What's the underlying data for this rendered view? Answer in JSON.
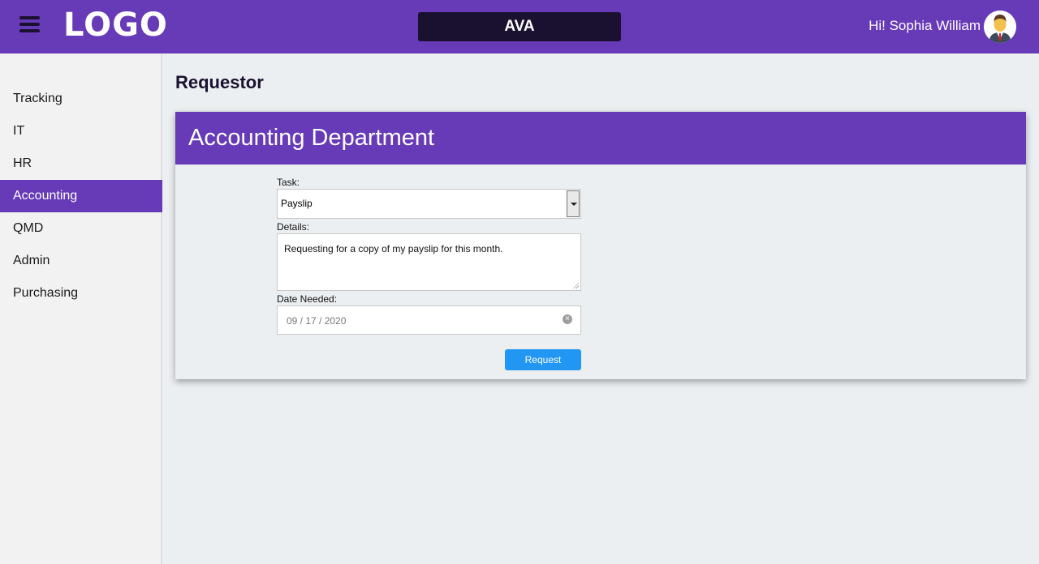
{
  "header": {
    "logo": "LOGO",
    "app_title": "AVA",
    "greeting": "Hi! Sophia William",
    "menu_icon": "hamburger-menu-icon",
    "avatar_icon": "user-avatar"
  },
  "sidebar": {
    "items": [
      {
        "label": "Tracking",
        "active": false
      },
      {
        "label": "IT",
        "active": false
      },
      {
        "label": "HR",
        "active": false
      },
      {
        "label": "Accounting",
        "active": true
      },
      {
        "label": "QMD",
        "active": false
      },
      {
        "label": "Admin",
        "active": false
      },
      {
        "label": "Purchasing",
        "active": false
      }
    ]
  },
  "main": {
    "page_title": "Requestor",
    "card_title": "Accounting Department",
    "form": {
      "task_label": "Task:",
      "task_value": "Payslip",
      "details_label": "Details:",
      "details_value": "Requesting for a copy of my payslip for this month.",
      "date_label": "Date Needed:",
      "date_value": "09 / 17 / 2020",
      "submit_label": "Request"
    }
  },
  "colors": {
    "primary": "#673ab7",
    "dark": "#1a1030",
    "button": "#2196f3",
    "background": "#eceff1"
  }
}
